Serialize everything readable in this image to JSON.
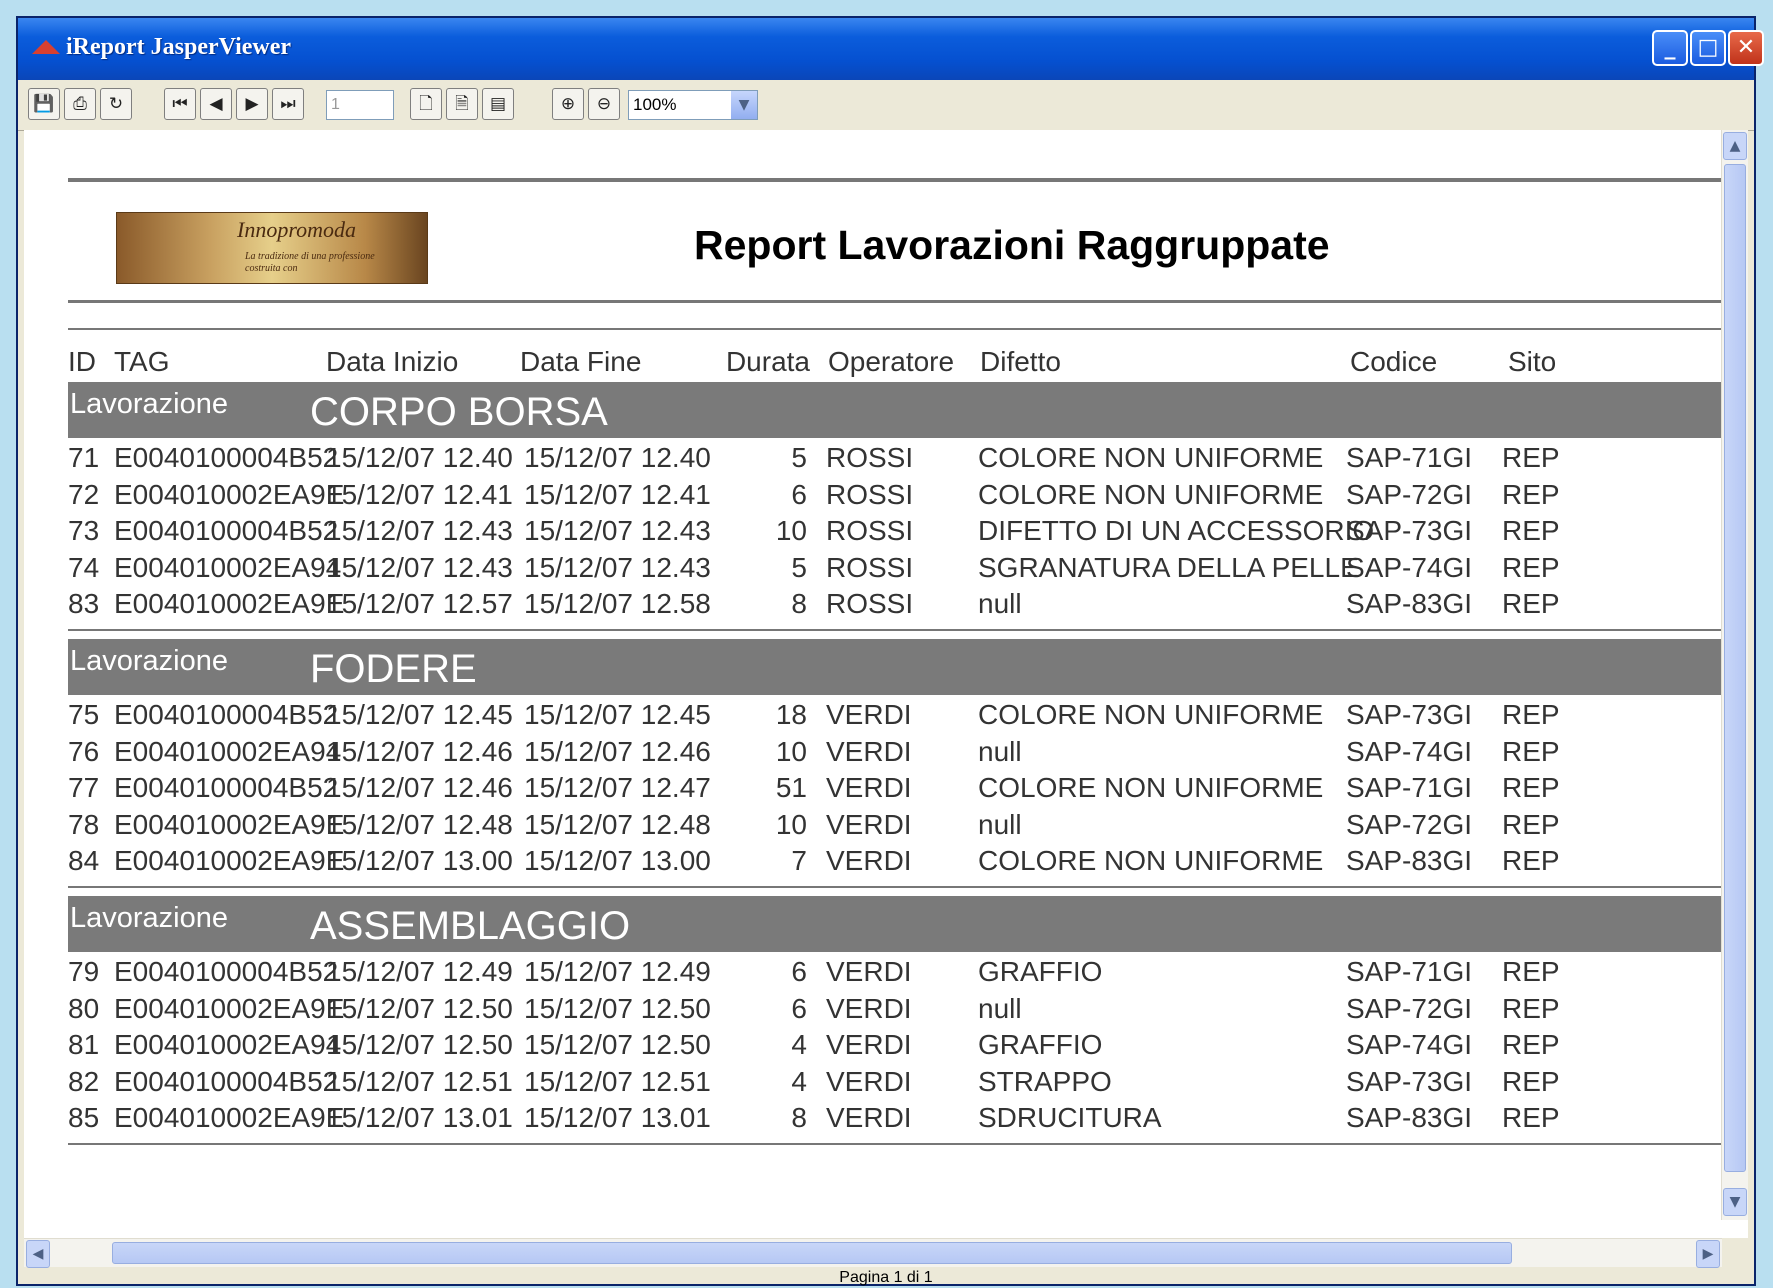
{
  "window": {
    "title": "iReport JasperViewer",
    "controls": {
      "minimize": "_",
      "maximize": "□",
      "close": "✕"
    }
  },
  "toolbar": {
    "page_number": "1",
    "zoom": "100%",
    "icons": [
      "save-icon",
      "print-icon",
      "reload-icon",
      "first-page-icon",
      "previous-page-icon",
      "next-page-icon",
      "last-page-icon",
      "actual-size-icon",
      "fit-page-icon",
      "fit-width-icon",
      "zoom-in-icon",
      "zoom-out-icon"
    ]
  },
  "report": {
    "logo_text": "Innopromoda",
    "logo_subtext": "La tradizione di una professione costruita con",
    "title": "Report Lavorazioni Raggruppate",
    "columns": {
      "id": "ID",
      "tag": "TAG",
      "data_inizio": "Data Inizio",
      "data_fine": "Data Fine",
      "durata": "Durata",
      "operatore": "Operatore",
      "difetto": "Difetto",
      "codice": "Codice",
      "sito": "Sito"
    },
    "group_label": "Lavorazione",
    "groups": [
      {
        "name": "CORPO BORSA",
        "rows": [
          {
            "id": "71",
            "tag": "E0040100004B52",
            "inizio": "15/12/07 12.40",
            "fine": "15/12/07 12.40",
            "durata": "5",
            "operatore": "ROSSI",
            "difetto": "COLORE NON UNIFORME",
            "codice": "SAP-71GI",
            "sito": "REP"
          },
          {
            "id": "72",
            "tag": "E004010002EA9E",
            "inizio": "15/12/07 12.41",
            "fine": "15/12/07 12.41",
            "durata": "6",
            "operatore": "ROSSI",
            "difetto": "COLORE NON UNIFORME",
            "codice": "SAP-72GI",
            "sito": "REP"
          },
          {
            "id": "73",
            "tag": "E0040100004B52",
            "inizio": "15/12/07 12.43",
            "fine": "15/12/07 12.43",
            "durata": "10",
            "operatore": "ROSSI",
            "difetto": "DIFETTO DI UN ACCESSORIO",
            "codice": "SAP-73GI",
            "sito": "REP"
          },
          {
            "id": "74",
            "tag": "E004010002EA94",
            "inizio": "15/12/07 12.43",
            "fine": "15/12/07 12.43",
            "durata": "5",
            "operatore": "ROSSI",
            "difetto": "SGRANATURA DELLA PELLE",
            "codice": "SAP-74GI",
            "sito": "REP"
          },
          {
            "id": "83",
            "tag": "E004010002EA9E",
            "inizio": "15/12/07 12.57",
            "fine": "15/12/07 12.58",
            "durata": "8",
            "operatore": "ROSSI",
            "difetto": "null",
            "codice": "SAP-83GI",
            "sito": "REP"
          }
        ]
      },
      {
        "name": "FODERE",
        "rows": [
          {
            "id": "75",
            "tag": "E0040100004B52",
            "inizio": "15/12/07 12.45",
            "fine": "15/12/07 12.45",
            "durata": "18",
            "operatore": "VERDI",
            "difetto": "COLORE NON UNIFORME",
            "codice": "SAP-73GI",
            "sito": "REP"
          },
          {
            "id": "76",
            "tag": "E004010002EA94",
            "inizio": "15/12/07 12.46",
            "fine": "15/12/07 12.46",
            "durata": "10",
            "operatore": "VERDI",
            "difetto": "null",
            "codice": "SAP-74GI",
            "sito": "REP"
          },
          {
            "id": "77",
            "tag": "E0040100004B52",
            "inizio": "15/12/07 12.46",
            "fine": "15/12/07 12.47",
            "durata": "51",
            "operatore": "VERDI",
            "difetto": "COLORE NON UNIFORME",
            "codice": "SAP-71GI",
            "sito": "REP"
          },
          {
            "id": "78",
            "tag": "E004010002EA9E",
            "inizio": "15/12/07 12.48",
            "fine": "15/12/07 12.48",
            "durata": "10",
            "operatore": "VERDI",
            "difetto": "null",
            "codice": "SAP-72GI",
            "sito": "REP"
          },
          {
            "id": "84",
            "tag": "E004010002EA9E",
            "inizio": "15/12/07 13.00",
            "fine": "15/12/07 13.00",
            "durata": "7",
            "operatore": "VERDI",
            "difetto": "COLORE NON UNIFORME",
            "codice": "SAP-83GI",
            "sito": "REP"
          }
        ]
      },
      {
        "name": "ASSEMBLAGGIO",
        "rows": [
          {
            "id": "79",
            "tag": "E0040100004B52",
            "inizio": "15/12/07 12.49",
            "fine": "15/12/07 12.49",
            "durata": "6",
            "operatore": "VERDI",
            "difetto": "GRAFFIO",
            "codice": "SAP-71GI",
            "sito": "REP"
          },
          {
            "id": "80",
            "tag": "E004010002EA9E",
            "inizio": "15/12/07 12.50",
            "fine": "15/12/07 12.50",
            "durata": "6",
            "operatore": "VERDI",
            "difetto": "null",
            "codice": "SAP-72GI",
            "sito": "REP"
          },
          {
            "id": "81",
            "tag": "E004010002EA94",
            "inizio": "15/12/07 12.50",
            "fine": "15/12/07 12.50",
            "durata": "4",
            "operatore": "VERDI",
            "difetto": "GRAFFIO",
            "codice": "SAP-74GI",
            "sito": "REP"
          },
          {
            "id": "82",
            "tag": "E0040100004B52",
            "inizio": "15/12/07 12.51",
            "fine": "15/12/07 12.51",
            "durata": "4",
            "operatore": "VERDI",
            "difetto": "STRAPPO",
            "codice": "SAP-73GI",
            "sito": "REP"
          },
          {
            "id": "85",
            "tag": "E004010002EA9E",
            "inizio": "15/12/07 13.01",
            "fine": "15/12/07 13.01",
            "durata": "8",
            "operatore": "VERDI",
            "difetto": "SDRUCITURA",
            "codice": "SAP-83GI",
            "sito": "REP"
          }
        ]
      }
    ]
  },
  "status": {
    "page_info": "Pagina 1 di 1"
  },
  "colors": {
    "titlebar": "#0550d0",
    "group_band": "#7a7a7a",
    "text": "#333333"
  }
}
